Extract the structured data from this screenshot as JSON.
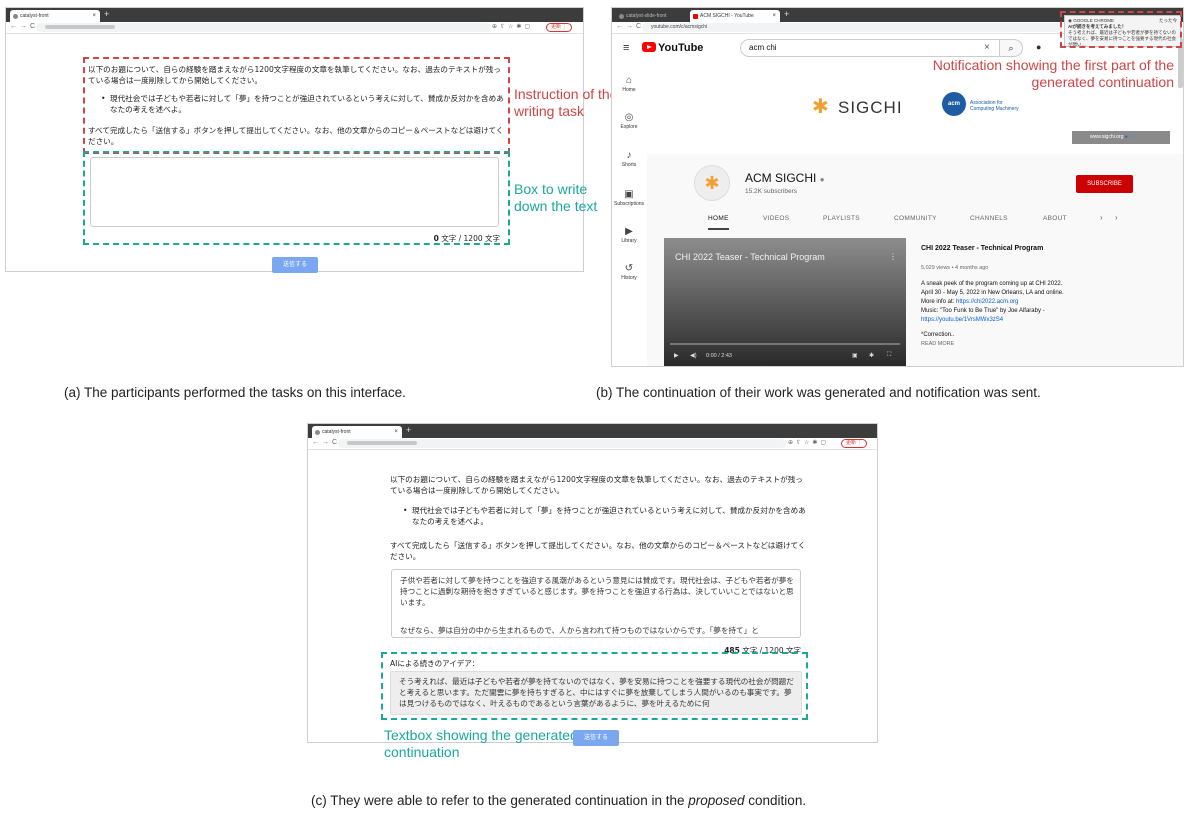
{
  "panel_a": {
    "tab_title": "catalyst-front",
    "instruction_1": "以下のお題について、自らの経験を踏まえながら1200文字程度の文章を執筆してください。なお、過去のテキストが残っている場合は一度削除してから開始してください。",
    "prompt": "現代社会では子どもや若者に対して「夢」を持つことが強迫されているという考えに対して、賛成か反対かを含めあなたの考えを述べよ。",
    "instruction_2": "すべて完成したら「送信する」ボタンを押して提出してください。なお、他の文章からのコピー＆ペーストなどは避けてください。",
    "count_value": "0",
    "count_suffix": " 文字 / 1200 文字",
    "submit_label": "送信する",
    "ann_instruction": "Instruction of the writing task",
    "ann_box": "Box to write down the text",
    "caption": "(a) The participants performed the tasks on this interface."
  },
  "panel_b": {
    "tab1_title": "catalyst-slide-front",
    "tab2_title": "ACM SIGCHI - YouTube",
    "url": "youtube.com/c/acmsigchi",
    "logo": "YouTube",
    "search_value": "acm chi",
    "sidebar": [
      {
        "icon": "⌂",
        "label": "Home"
      },
      {
        "icon": "◎",
        "label": "Explore"
      },
      {
        "icon": "♪",
        "label": "Shorts"
      },
      {
        "icon": "▣",
        "label": "Subscriptions"
      },
      {
        "icon": "▶",
        "label": "Library"
      },
      {
        "icon": "↺",
        "label": "History"
      }
    ],
    "sigchi": "SIGCHI",
    "acm_badge": "acm",
    "acm_line1": "Association for",
    "acm_line2": "Computing Machinery",
    "links_text": "www.sigchi.org",
    "channel_name": "ACM SIGCHI",
    "subscribers": "15.2K subscribers",
    "subscribe_label": "SUBSCRIBE",
    "tabs": [
      "HOME",
      "VIDEOS",
      "PLAYLISTS",
      "COMMUNITY",
      "CHANNELS",
      "ABOUT"
    ],
    "video_title": "CHI 2022 Teaser - Technical Program",
    "video_time": "0:00 / 2:43",
    "info_title": "CHI 2022 Teaser - Technical Program",
    "info_meta": "5,029 views • 4 months ago",
    "desc_1": "A sneak peek of the program coming up at CHI 2022.",
    "desc_2": "April 30 - May 5, 2022 in New Orleans, LA and online.",
    "desc_3": "More info at: ",
    "desc_3_link": "https://chi2022.acm.org",
    "desc_4": "Music: \"Too Funk to Be True\" by Joe Alfaraby -",
    "desc_5_link": "https://youtu.be/1VrsMWx3zS4",
    "desc_6": "*Correction..",
    "read_more": "READ MORE",
    "notif_app": "GOOGLE CHROME",
    "notif_time": "たった今",
    "notif_title": "AIが続きを考えてみました！",
    "notif_body": "そう考えれば、最近は子どもや若者が夢を持てないのではなく、夢を安易に持つことを強要する現代の社会が問い…",
    "ann_notification": "Notification showing the first part of the generated continuation",
    "caption": "(b) The continuation of their work was generated and notification was sent."
  },
  "panel_c": {
    "typed_1": "子供や若者に対して夢を持つことを強迫する風潮があるという意見には賛成です。現代社会は、子どもや若者が夢を持つことに過剰な期待を抱きすぎていると感じます。夢を持つことを強迫する行為は、決していいことではないと思います。",
    "typed_2": "なぜなら、夢は自分の中から生まれるもので、人から言われて持つものではないからです。「夢を持て」と",
    "count_value": "485",
    "count_suffix": " 文字 / 1200 文字",
    "ai_label": "AIによる続きのアイデア：",
    "generated": "そう考えれば、最近は子どもや若者が夢を持てないのではなく、夢を安易に持つことを強要する現代の社会が問題だと考えると思います。ただ闇雲に夢を持ちすぎると、中にはすぐに夢を放棄してしまう人間がいるのも事実です。夢は見つけるものではなく、叶えるものであるという言葉があるように、夢を叶えるために何",
    "submit_label": "送信する",
    "ann_textbox": "Textbox showing the generated continuation",
    "caption_pre": "(c) They were able to refer to the generated continuation in the ",
    "caption_em": "proposed",
    "caption_post": " condition."
  }
}
